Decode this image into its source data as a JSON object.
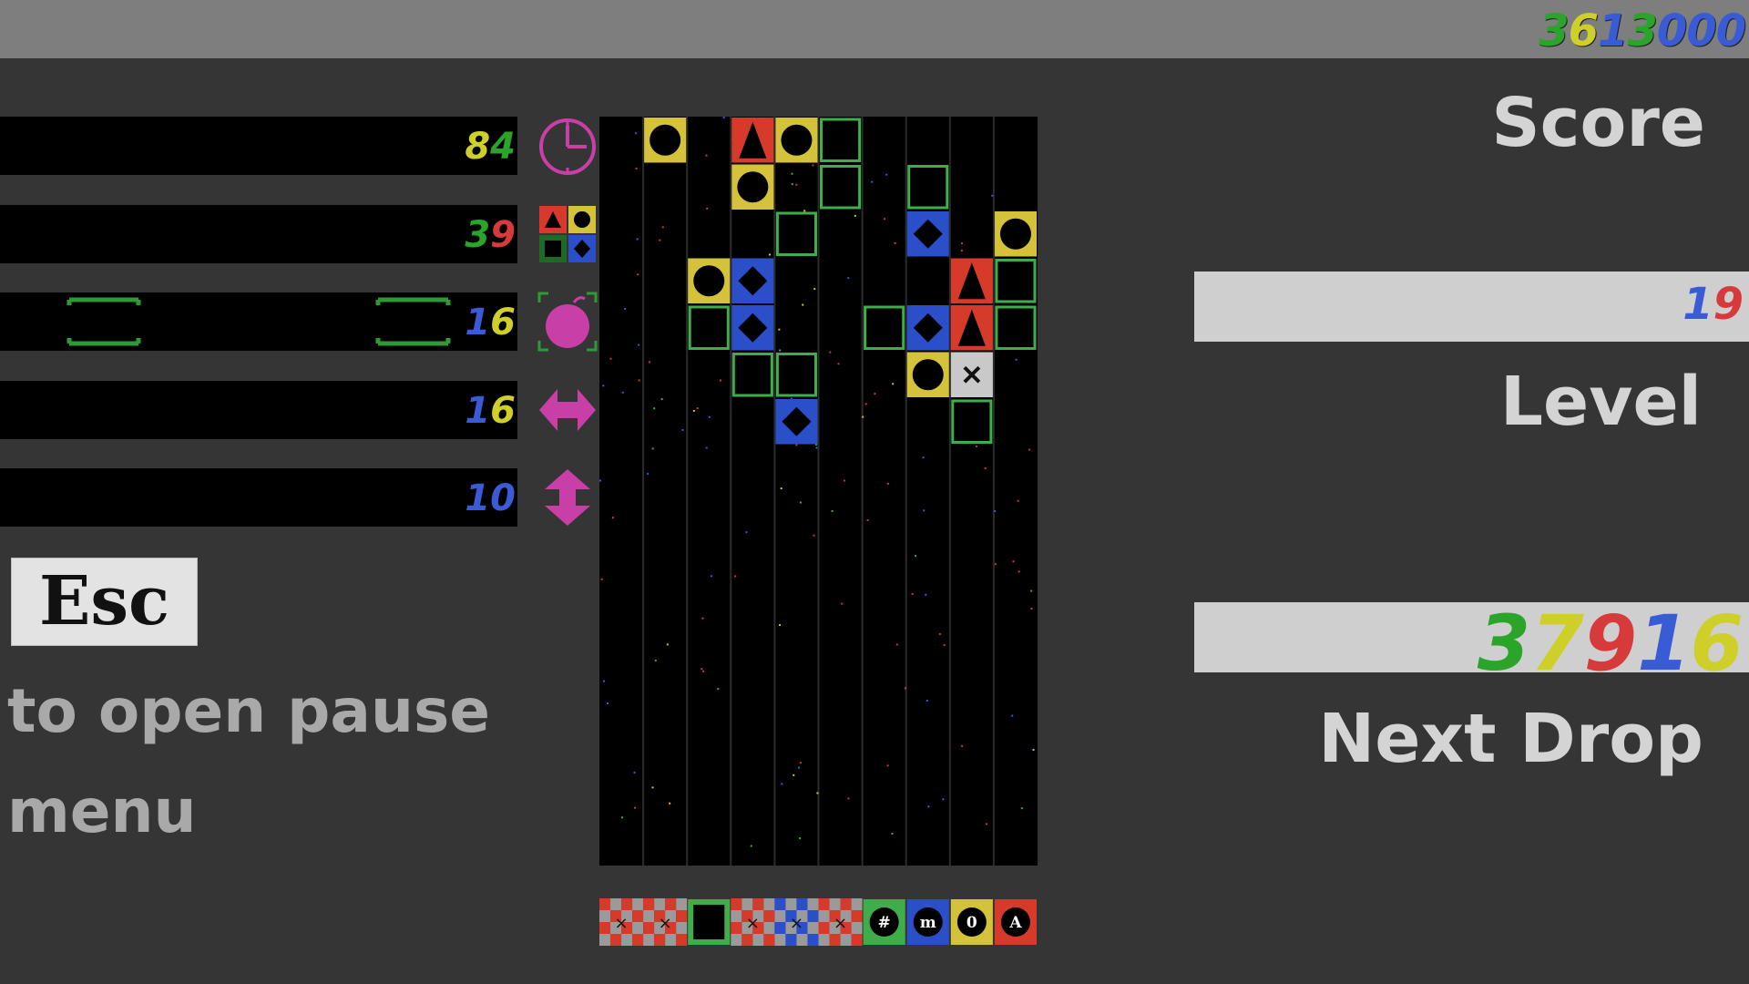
{
  "header": {
    "score_digits": [
      {
        "d": "3",
        "c": "#2aa52a"
      },
      {
        "d": "6",
        "c": "#cfcf2a"
      },
      {
        "d": "1",
        "c": "#3a5bd6"
      },
      {
        "d": "3",
        "c": "#2aa52a"
      },
      {
        "d": "0",
        "c": "#3a5bd6"
      },
      {
        "d": "0",
        "c": "#3a5bd6"
      },
      {
        "d": "0",
        "c": "#3a5bd6"
      }
    ]
  },
  "right_panel": {
    "score_label": "Score",
    "level_label": "Level",
    "next_drop_label": "Next Drop",
    "level_digits": [
      {
        "d": "1",
        "c": "#3a5bd6"
      },
      {
        "d": "9",
        "c": "#d63a3a"
      }
    ],
    "next_drop_digits": [
      {
        "d": "3",
        "c": "#2aa52a"
      },
      {
        "d": "7",
        "c": "#cfcf2a"
      },
      {
        "d": "9",
        "c": "#d63a3a"
      },
      {
        "d": "1",
        "c": "#3a5bd6"
      },
      {
        "d": "6",
        "c": "#cfcf2a"
      }
    ]
  },
  "stats": [
    {
      "icon": "clock-icon",
      "digits": [
        {
          "d": "8",
          "c": "#cfcf2a"
        },
        {
          "d": "4",
          "c": "#2aa52a"
        }
      ]
    },
    {
      "icon": "colors-icon",
      "digits": [
        {
          "d": "3",
          "c": "#2aa52a"
        },
        {
          "d": "9",
          "c": "#d63a3a"
        }
      ]
    },
    {
      "icon": "bomb-icon",
      "digits": [
        {
          "d": "1",
          "c": "#3a5bd6"
        },
        {
          "d": "6",
          "c": "#cfcf2a"
        }
      ]
    },
    {
      "icon": "horizontal-arrows-icon",
      "digits": [
        {
          "d": "1",
          "c": "#3a5bd6"
        },
        {
          "d": "6",
          "c": "#cfcf2a"
        }
      ]
    },
    {
      "icon": "vertical-arrows-icon",
      "digits": [
        {
          "d": "1",
          "c": "#3a5bd6"
        },
        {
          "d": "0",
          "c": "#3a5bd6"
        }
      ]
    }
  ],
  "pause_hint": {
    "key_label": "Esc",
    "text": "to open pause menu"
  },
  "board": {
    "columns": 10,
    "rows": 17,
    "pieces": [
      {
        "col": 1,
        "row": 0,
        "type": "circle",
        "color": "yellow"
      },
      {
        "col": 3,
        "row": 0,
        "type": "triangle",
        "color": "red"
      },
      {
        "col": 4,
        "row": 0,
        "type": "circle",
        "color": "yellow"
      },
      {
        "col": 5,
        "row": 0,
        "type": "empty",
        "color": "green"
      },
      {
        "col": 3,
        "row": 1,
        "type": "circle",
        "color": "yellow"
      },
      {
        "col": 5,
        "row": 1,
        "type": "empty",
        "color": "green"
      },
      {
        "col": 7,
        "row": 1,
        "type": "empty",
        "color": "green"
      },
      {
        "col": 4,
        "row": 2,
        "type": "empty",
        "color": "green"
      },
      {
        "col": 7,
        "row": 2,
        "type": "diamond",
        "color": "blue"
      },
      {
        "col": 9,
        "row": 2,
        "type": "circle",
        "color": "yellow"
      },
      {
        "col": 2,
        "row": 3,
        "type": "circle",
        "color": "yellow"
      },
      {
        "col": 3,
        "row": 3,
        "type": "diamond",
        "color": "blue"
      },
      {
        "col": 8,
        "row": 3,
        "type": "triangle",
        "color": "red"
      },
      {
        "col": 9,
        "row": 3,
        "type": "empty",
        "color": "green"
      },
      {
        "col": 2,
        "row": 4,
        "type": "empty",
        "color": "green"
      },
      {
        "col": 3,
        "row": 4,
        "type": "diamond",
        "color": "blue"
      },
      {
        "col": 6,
        "row": 4,
        "type": "empty",
        "color": "green"
      },
      {
        "col": 7,
        "row": 4,
        "type": "diamond",
        "color": "blue"
      },
      {
        "col": 8,
        "row": 4,
        "type": "triangle",
        "color": "red"
      },
      {
        "col": 9,
        "row": 4,
        "type": "empty",
        "color": "green"
      },
      {
        "col": 3,
        "row": 5,
        "type": "empty",
        "color": "green"
      },
      {
        "col": 4,
        "row": 5,
        "type": "empty",
        "color": "green"
      },
      {
        "col": 7,
        "row": 5,
        "type": "circle",
        "color": "yellow"
      },
      {
        "col": 8,
        "row": 5,
        "type": "cross",
        "color": "grey"
      },
      {
        "col": 4,
        "row": 6,
        "type": "diamond",
        "color": "blue"
      },
      {
        "col": 8,
        "row": 6,
        "type": "empty",
        "color": "green"
      }
    ]
  },
  "queue": [
    {
      "type": "cross",
      "color": "checker"
    },
    {
      "type": "cross",
      "color": "checker"
    },
    {
      "type": "dot",
      "color": "green"
    },
    {
      "type": "cross",
      "color": "checker"
    },
    {
      "type": "cross",
      "color": "checker-blue"
    },
    {
      "type": "cross",
      "color": "checker"
    },
    {
      "type": "glyph",
      "color": "green",
      "label": "#"
    },
    {
      "type": "glyph",
      "color": "blue",
      "label": "m"
    },
    {
      "type": "glyph",
      "color": "yellow",
      "label": "0"
    },
    {
      "type": "glyph",
      "color": "red",
      "label": "A"
    }
  ],
  "colors": {
    "red": "#d63a2a",
    "yellow": "#d4c23a",
    "blue": "#2a4fc8",
    "green": "#3fae4a",
    "grey": "#c9c9c9",
    "pink": "#c93fa8"
  }
}
